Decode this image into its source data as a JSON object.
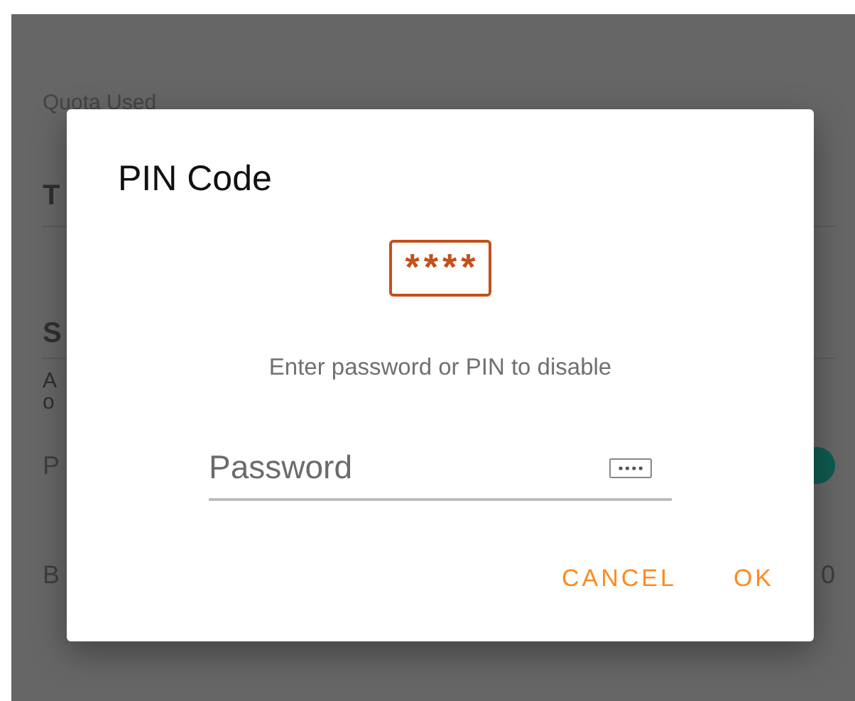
{
  "background": {
    "quota_label": "Quota Used",
    "section_1": "T",
    "section_2": "S",
    "description_lines": [
      "A",
      "o"
    ],
    "setting_1": "P",
    "setting_1_switch_on": true,
    "setting_2": "B",
    "setting_2_value": "0"
  },
  "dialog": {
    "title": "PIN Code",
    "pin_badge": "****",
    "message": "Enter password or PIN to disable",
    "password": {
      "placeholder": "Password"
    },
    "buttons": [
      {
        "label": "CANCEL"
      },
      {
        "label": "OK"
      }
    ]
  }
}
